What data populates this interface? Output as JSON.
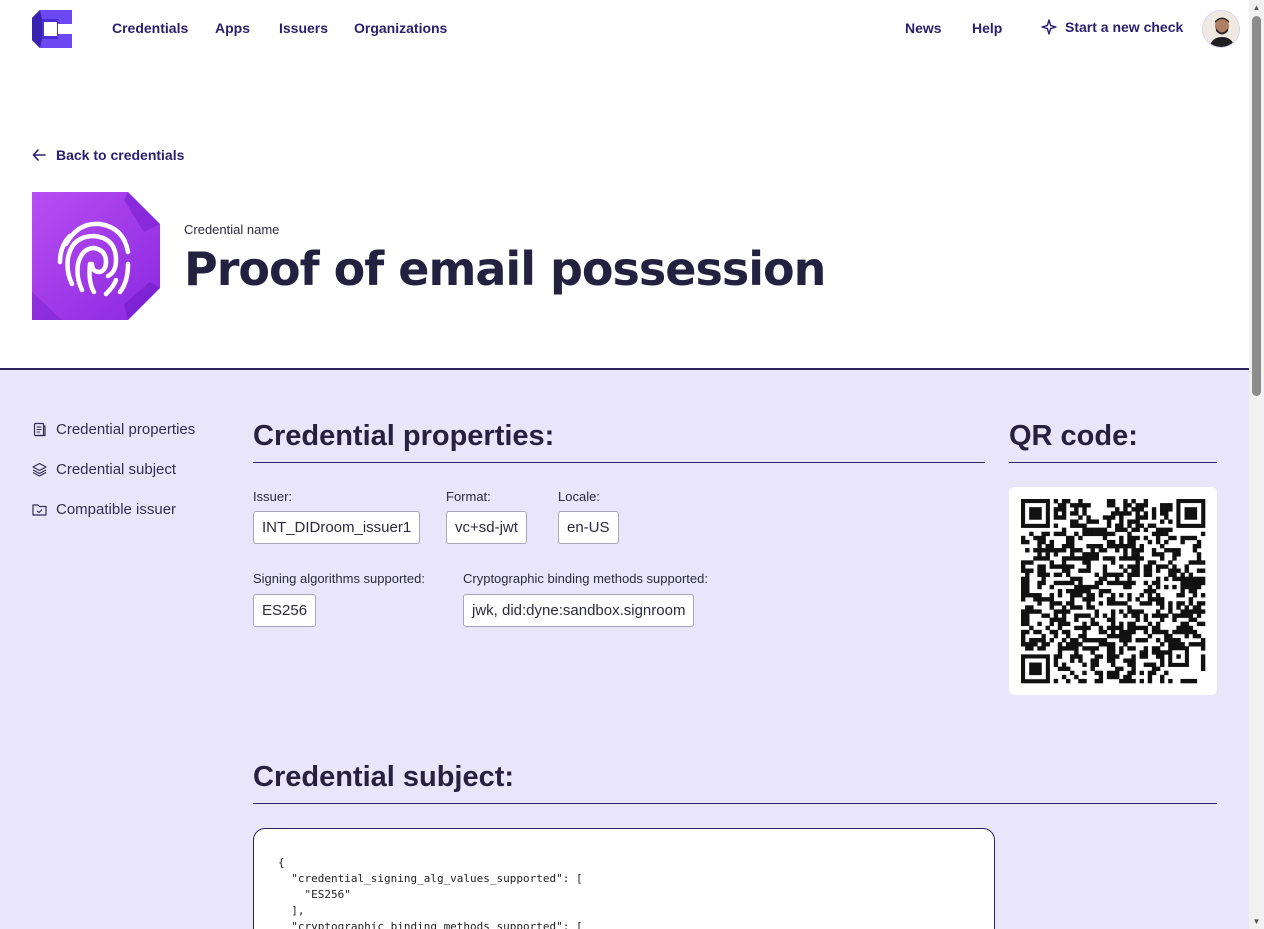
{
  "nav": {
    "logo_alt": "Credimi logo",
    "links": [
      "Credentials",
      "Apps",
      "Issuers",
      "Organizations"
    ],
    "right_links": [
      "News",
      "Help"
    ],
    "start_check": "Start a new check"
  },
  "header": {
    "back_label": "Back to credentials",
    "credential_label": "Credential name",
    "credential_title": "Proof of email possession"
  },
  "sidebar": {
    "items": [
      {
        "label": "Credential properties",
        "icon": "document-icon"
      },
      {
        "label": "Credential subject",
        "icon": "layers-icon"
      },
      {
        "label": "Compatible issuer",
        "icon": "folder-icon"
      }
    ]
  },
  "properties": {
    "heading": "Credential properties:",
    "issuer_label": "Issuer:",
    "issuer_value": "INT_DIDroom_issuer1",
    "format_label": "Format:",
    "format_value": "vc+sd-jwt",
    "locale_label": "Locale:",
    "locale_value": "en-US",
    "signing_label": "Signing algorithms supported:",
    "signing_value": "ES256",
    "binding_label": "Cryptographic binding methods supported:",
    "binding_value": "jwk, did:dyne:sandbox.signroom"
  },
  "qr": {
    "heading": "QR code:"
  },
  "subject": {
    "heading": "Credential subject:",
    "code": "{\n  \"credential_signing_alg_values_supported\": [\n    \"ES256\"\n  ],\n  \"cryptographic_binding_methods_supported\": ["
  },
  "colors": {
    "primary": "#2a1f6e",
    "section_bg": "#e9e6fb",
    "icon_purple": "#9b30e6"
  }
}
